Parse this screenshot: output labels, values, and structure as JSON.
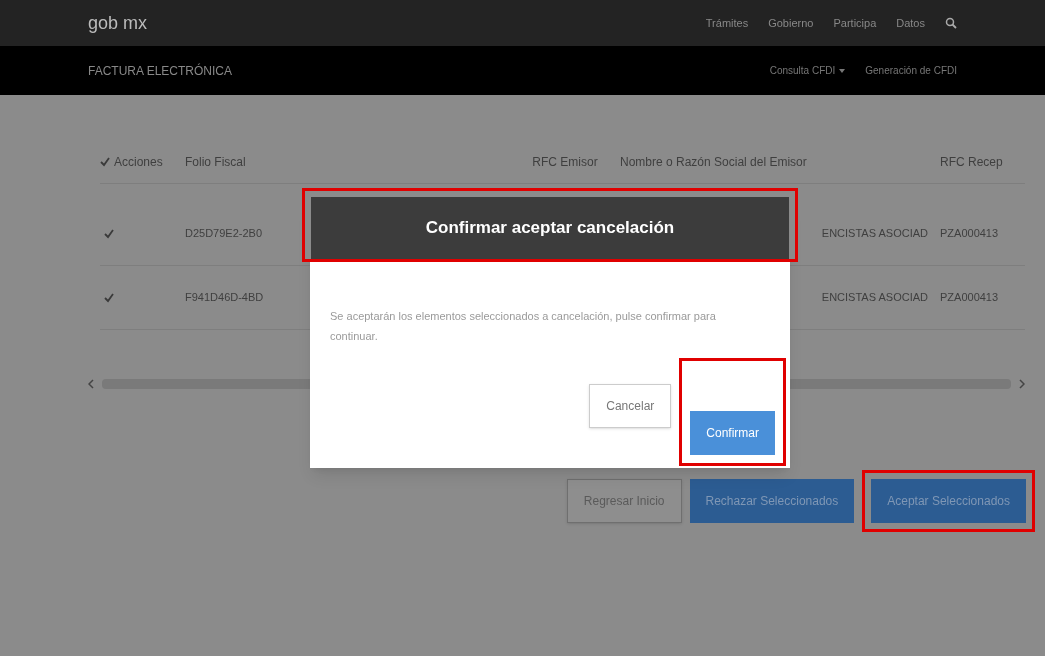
{
  "top_bar": {
    "logo": "gob mx",
    "links": [
      "Trámites",
      "Gobierno",
      "Participa",
      "Datos"
    ]
  },
  "sub_bar": {
    "title": "FACTURA ELECTRÓNICA",
    "links": [
      {
        "label": "Consulta CFDI",
        "dropdown": true
      },
      {
        "label": "Generación de CFDI",
        "dropdown": false
      }
    ]
  },
  "table": {
    "header_checked": true,
    "columns": [
      "Acciones",
      "Folio Fiscal",
      "RFC Emisor",
      "Nombre o Razón Social del Emisor",
      "RFC Recep"
    ],
    "rows": [
      {
        "checked": true,
        "folio": "D25D79E2-2B0",
        "rfc_emisor": "",
        "nombre": "ENCISTAS ASOCIAD",
        "rfc_receptor": "PZA000413"
      },
      {
        "checked": true,
        "folio": "F941D46D-4BD",
        "rfc_emisor": "",
        "nombre": "ENCISTAS ASOCIAD",
        "rfc_receptor": "PZA000413"
      }
    ]
  },
  "actions": [
    {
      "label": "Regresar Inicio",
      "kind": "secondary",
      "highlighted": false
    },
    {
      "label": "Rechazar Seleccionados",
      "kind": "primary",
      "highlighted": false
    },
    {
      "label": "Aceptar Seleccionados",
      "kind": "primary",
      "highlighted": true
    }
  ],
  "dialog": {
    "title": "Confirmar aceptar cancelación",
    "title_highlighted": true,
    "message": "Se aceptarán los elementos seleccionados a cancelación, pulse confirmar para continuar.",
    "buttons": [
      {
        "label": "Cancelar",
        "kind": "secondary",
        "highlighted": false
      },
      {
        "label": "Confirmar",
        "kind": "primary",
        "highlighted": true
      }
    ]
  }
}
